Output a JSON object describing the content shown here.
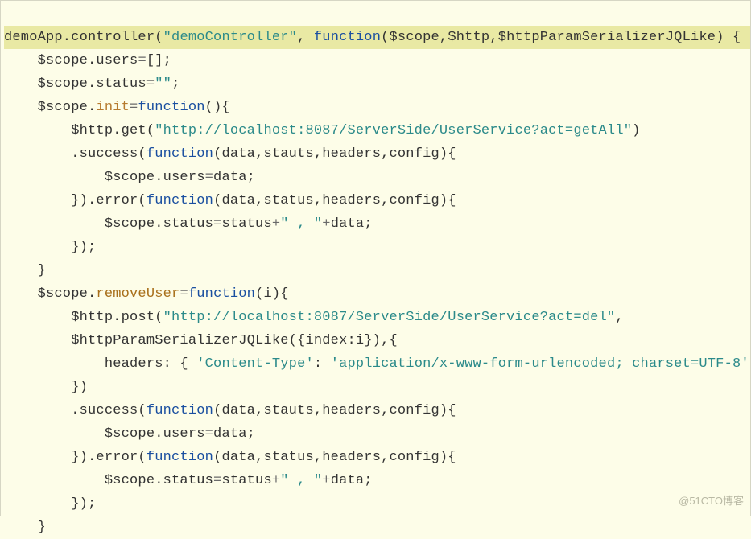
{
  "watermark": "@51CTO博客",
  "code": {
    "l1": {
      "a": "demoApp.controller(",
      "b": "\"demoController\"",
      "c": ", ",
      "d": "function",
      "e": "($scope,$http,$httpParamSerializerJQLike) {"
    },
    "l2": {
      "a": "    $scope.users",
      "b": "=",
      "c": "[];"
    },
    "l3": {
      "a": "    $scope.status",
      "b": "=",
      "c": "\"\"",
      "d": ";"
    },
    "l4": {
      "a": "    $scope.",
      "b": "init",
      "c": "=",
      "d": "function",
      "e": "(){"
    },
    "l5": {
      "a": "        $http.get(",
      "b": "\"http://localhost:8087/ServerSide/UserService?act=getAll\"",
      "c": ")"
    },
    "l6": {
      "a": "        .success(",
      "b": "function",
      "c": "(data,stauts,headers,config){"
    },
    "l7": {
      "a": "            $scope.users",
      "b": "=",
      "c": "data;"
    },
    "l8": {
      "a": "        }).error(",
      "b": "function",
      "c": "(data,status,headers,config){"
    },
    "l9": {
      "a": "            $scope.status",
      "b": "=",
      "c": "status",
      "d": "+",
      "e": "\" , \"",
      "f": "+",
      "g": "data;"
    },
    "l10": {
      "a": "        });"
    },
    "l11": {
      "a": "    }"
    },
    "l12": {
      "a": "    $scope.",
      "b": "removeUser",
      "c": "=",
      "d": "function",
      "e": "(i){"
    },
    "l13": {
      "a": "        $http.post(",
      "b": "\"http://localhost:8087/ServerSide/UserService?act=del\"",
      "c": ","
    },
    "l14": {
      "a": "        $httpParamSerializerJQLike({index:i}),{"
    },
    "l15": {
      "a": "            headers: { ",
      "b": "'Content-Type'",
      "c": ": ",
      "d": "'application/x-www-form-urlencoded; charset=UTF-8'",
      "e": " }"
    },
    "l16": {
      "a": "        })"
    },
    "l17": {
      "a": "        .success(",
      "b": "function",
      "c": "(data,stauts,headers,config){"
    },
    "l18": {
      "a": "            $scope.users",
      "b": "=",
      "c": "data;"
    },
    "l19": {
      "a": "        }).error(",
      "b": "function",
      "c": "(data,status,headers,config){"
    },
    "l20": {
      "a": "            $scope.status",
      "b": "=",
      "c": "status",
      "d": "+",
      "e": "\" , \"",
      "f": "+",
      "g": "data;"
    },
    "l21": {
      "a": "        });"
    },
    "l22": {
      "a": "    }"
    }
  }
}
